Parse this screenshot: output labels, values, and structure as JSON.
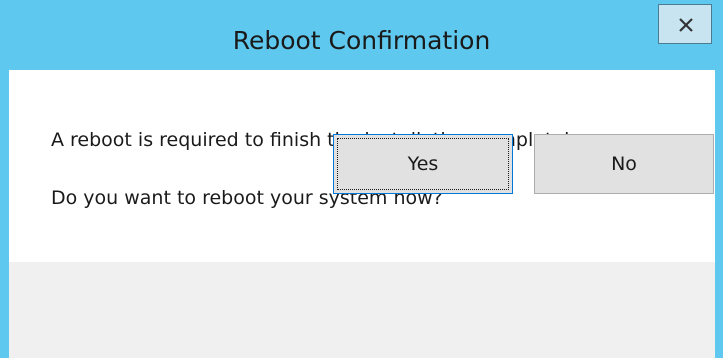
{
  "window": {
    "title": "Reboot Confirmation",
    "close_icon": "close-icon"
  },
  "message": {
    "line1": "A reboot is required to finish the installation completely.",
    "line2": "Do you want to reboot your system now?"
  },
  "buttons": {
    "yes_label": "Yes",
    "no_label": "No"
  },
  "colors": {
    "titlebar": "#5ec8ee",
    "close_button": "#c7e4f0",
    "footer": "#f0f0f0",
    "button_face": "#e1e1e1",
    "focus_border": "#0078d7"
  }
}
